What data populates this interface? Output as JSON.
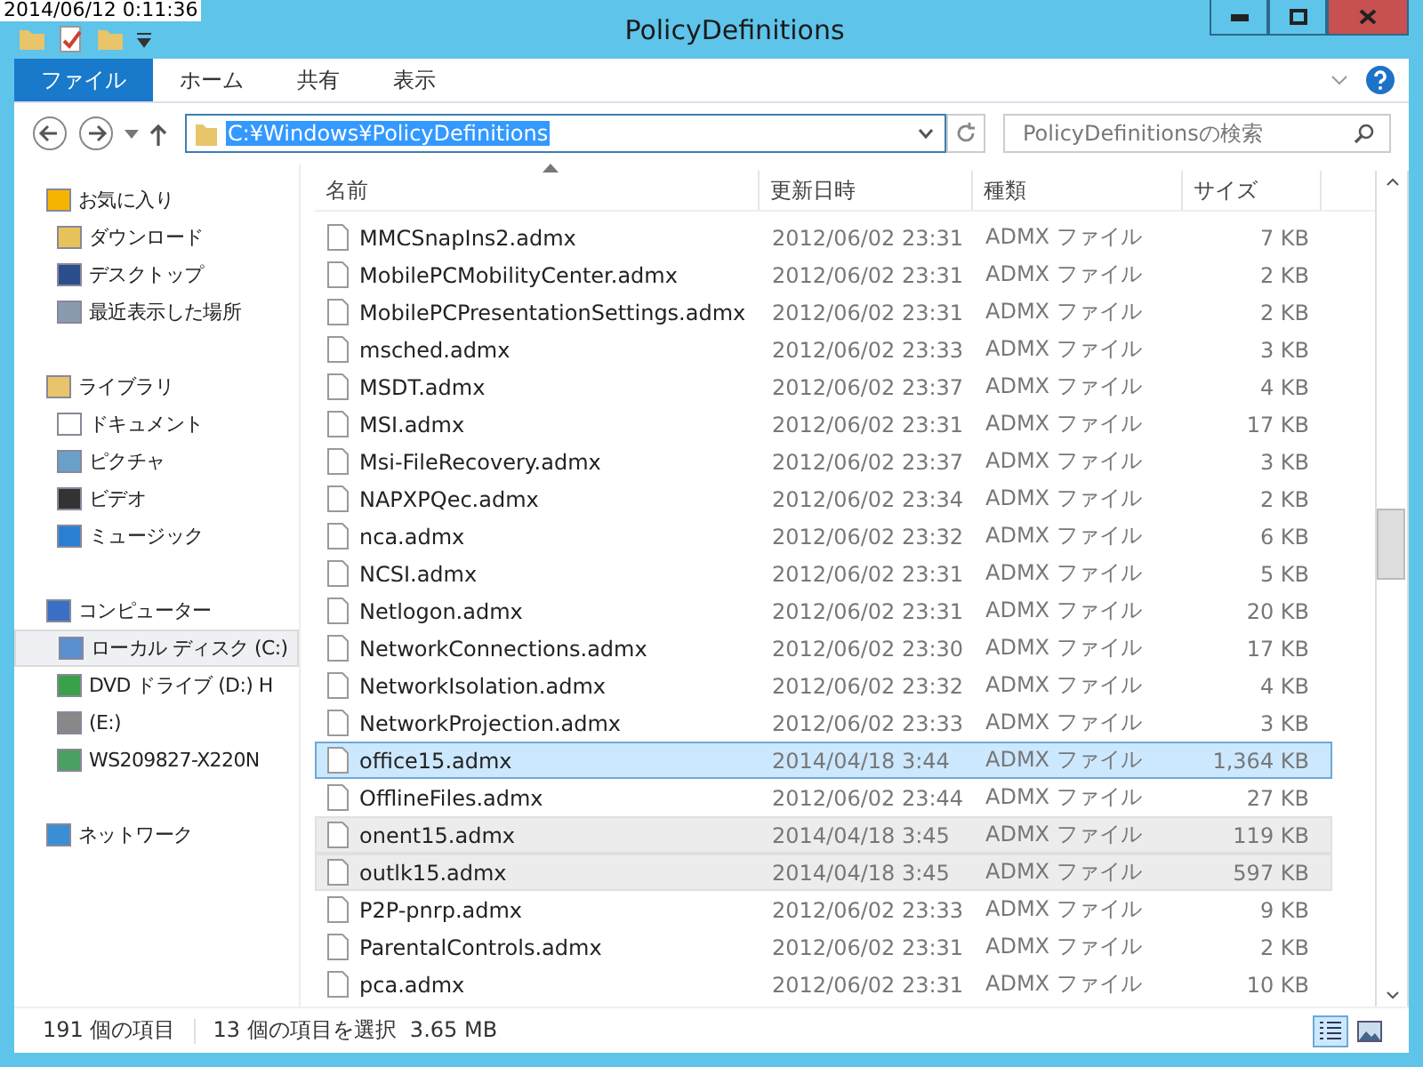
{
  "overlay_timestamp": "2014/06/12 0:11:36",
  "window": {
    "title": "PolicyDefinitions"
  },
  "ribbon_tabs": [
    {
      "label": "ファイル",
      "selected": true
    },
    {
      "label": "ホーム",
      "selected": false
    },
    {
      "label": "共有",
      "selected": false
    },
    {
      "label": "表示",
      "selected": false
    }
  ],
  "address": {
    "value": "C:¥Windows¥PolicyDefinitions"
  },
  "search": {
    "placeholder": "PolicyDefinitionsの検索"
  },
  "sidebar": {
    "groups": [
      {
        "label": "お気に入り",
        "kind": "star",
        "children": [
          {
            "label": "ダウンロード",
            "kind": "download",
            "selected": false
          },
          {
            "label": "デスクトップ",
            "kind": "desktop",
            "selected": false
          },
          {
            "label": "最近表示した場所",
            "kind": "recent",
            "selected": false
          }
        ]
      },
      {
        "label": "ライブラリ",
        "kind": "library",
        "children": [
          {
            "label": "ドキュメント",
            "kind": "document",
            "selected": false
          },
          {
            "label": "ピクチャ",
            "kind": "picture",
            "selected": false
          },
          {
            "label": "ビデオ",
            "kind": "video",
            "selected": false
          },
          {
            "label": "ミュージック",
            "kind": "music",
            "selected": false
          }
        ]
      },
      {
        "label": "コンピューター",
        "kind": "computer",
        "children": [
          {
            "label": "ローカル ディスク (C:)",
            "kind": "disk",
            "selected": true
          },
          {
            "label": "DVD ドライブ (D:) H",
            "kind": "dvd",
            "selected": false
          },
          {
            "label": "(E:)",
            "kind": "drive",
            "selected": false
          },
          {
            "label": "WS209827-X220N",
            "kind": "netdrive",
            "selected": false
          }
        ]
      },
      {
        "label": "ネットワーク",
        "kind": "network"
      }
    ]
  },
  "table": {
    "columns": [
      "名前",
      "更新日時",
      "種類",
      "サイズ"
    ],
    "rows": [
      {
        "name": "MMCSnapIns2.admx",
        "date": "2012/06/02 23:31",
        "type": "ADMX ファイル",
        "size": "7 KB",
        "selected": false,
        "focused": false
      },
      {
        "name": "MobilePCMobilityCenter.admx",
        "date": "2012/06/02 23:31",
        "type": "ADMX ファイル",
        "size": "2 KB",
        "selected": false,
        "focused": false
      },
      {
        "name": "MobilePCPresentationSettings.admx",
        "date": "2012/06/02 23:31",
        "type": "ADMX ファイル",
        "size": "2 KB",
        "selected": false,
        "focused": false
      },
      {
        "name": "msched.admx",
        "date": "2012/06/02 23:33",
        "type": "ADMX ファイル",
        "size": "3 KB",
        "selected": false,
        "focused": false
      },
      {
        "name": "MSDT.admx",
        "date": "2012/06/02 23:37",
        "type": "ADMX ファイル",
        "size": "4 KB",
        "selected": false,
        "focused": false
      },
      {
        "name": "MSI.admx",
        "date": "2012/06/02 23:31",
        "type": "ADMX ファイル",
        "size": "17 KB",
        "selected": false,
        "focused": false
      },
      {
        "name": "Msi-FileRecovery.admx",
        "date": "2012/06/02 23:37",
        "type": "ADMX ファイル",
        "size": "3 KB",
        "selected": false,
        "focused": false
      },
      {
        "name": "NAPXPQec.admx",
        "date": "2012/06/02 23:34",
        "type": "ADMX ファイル",
        "size": "2 KB",
        "selected": false,
        "focused": false
      },
      {
        "name": "nca.admx",
        "date": "2012/06/02 23:32",
        "type": "ADMX ファイル",
        "size": "6 KB",
        "selected": false,
        "focused": false
      },
      {
        "name": "NCSI.admx",
        "date": "2012/06/02 23:31",
        "type": "ADMX ファイル",
        "size": "5 KB",
        "selected": false,
        "focused": false
      },
      {
        "name": "Netlogon.admx",
        "date": "2012/06/02 23:31",
        "type": "ADMX ファイル",
        "size": "20 KB",
        "selected": false,
        "focused": false
      },
      {
        "name": "NetworkConnections.admx",
        "date": "2012/06/02 23:30",
        "type": "ADMX ファイル",
        "size": "17 KB",
        "selected": false,
        "focused": false
      },
      {
        "name": "NetworkIsolation.admx",
        "date": "2012/06/02 23:32",
        "type": "ADMX ファイル",
        "size": "4 KB",
        "selected": false,
        "focused": false
      },
      {
        "name": "NetworkProjection.admx",
        "date": "2012/06/02 23:33",
        "type": "ADMX ファイル",
        "size": "3 KB",
        "selected": false,
        "focused": false
      },
      {
        "name": "office15.admx",
        "date": "2014/04/18 3:44",
        "type": "ADMX ファイル",
        "size": "1,364 KB",
        "selected": true,
        "focused": true
      },
      {
        "name": "OfflineFiles.admx",
        "date": "2012/06/02 23:44",
        "type": "ADMX ファイル",
        "size": "27 KB",
        "selected": false,
        "focused": false
      },
      {
        "name": "onent15.admx",
        "date": "2014/04/18 3:45",
        "type": "ADMX ファイル",
        "size": "119 KB",
        "selected": true,
        "focused": false
      },
      {
        "name": "outlk15.admx",
        "date": "2014/04/18 3:45",
        "type": "ADMX ファイル",
        "size": "597 KB",
        "selected": true,
        "focused": false
      },
      {
        "name": "P2P-pnrp.admx",
        "date": "2012/06/02 23:33",
        "type": "ADMX ファイル",
        "size": "9 KB",
        "selected": false,
        "focused": false
      },
      {
        "name": "ParentalControls.admx",
        "date": "2012/06/02 23:31",
        "type": "ADMX ファイル",
        "size": "2 KB",
        "selected": false,
        "focused": false
      },
      {
        "name": "pca.admx",
        "date": "2012/06/02 23:31",
        "type": "ADMX ファイル",
        "size": "10 KB",
        "selected": false,
        "focused": false
      }
    ]
  },
  "status_bar": {
    "item_count": "191 個の項目",
    "selection": "13 個の項目を選択  3.65 MB"
  }
}
